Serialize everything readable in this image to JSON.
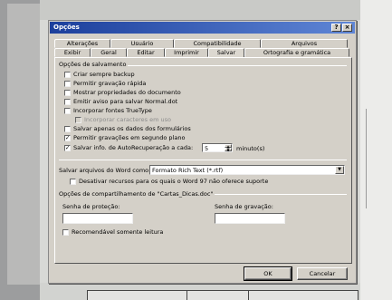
{
  "dialog": {
    "title": "Opções",
    "help_btn": "?",
    "close_btn": "×"
  },
  "tabs_back": [
    "Alterações",
    "Usuário",
    "Compatibilidade",
    "Arquivos"
  ],
  "tabs_front": [
    "Exibir",
    "Geral",
    "Editar",
    "Imprimir",
    "Salvar",
    "Ortografia e gramática"
  ],
  "active_tab": "Salvar",
  "save_options": {
    "group_label": "Opções de salvamento",
    "items": [
      {
        "label": "Criar sempre backup",
        "checked": false
      },
      {
        "label": "Permitir gravação rápida",
        "checked": false
      },
      {
        "label": "Mostrar propriedades do documento",
        "checked": false
      },
      {
        "label": "Emitir aviso para salvar Normal.dot",
        "checked": false
      },
      {
        "label": "Incorporar fontes TrueType",
        "checked": false
      },
      {
        "label": "Incorporar caracteres em uso",
        "checked": false,
        "disabled": true
      },
      {
        "label": "Salvar apenas os dados dos formulários",
        "checked": false
      },
      {
        "label": "Permitir gravações em segundo plano",
        "checked": true
      },
      {
        "label": "Salvar info. de AutoRecuperação a cada:",
        "checked": true
      }
    ],
    "autorecover_minutes": "5",
    "minutes_label": "minuto(s)"
  },
  "format": {
    "label": "Salvar arquivos do Word como:",
    "value": "Formato Rich Text (*.rtf)",
    "disable_label": "Desativar recursos para os quais o Word 97 não oferece suporte"
  },
  "sharing": {
    "group_label": "Opções de compartilhamento de \"Cartas_Dicas.doc\"",
    "protect_label": "Senha de proteção:",
    "write_label": "Senha de gravação:",
    "readonly_label": "Recomendável somente leitura"
  },
  "buttons": {
    "ok": "OK",
    "cancel": "Cancelar"
  }
}
